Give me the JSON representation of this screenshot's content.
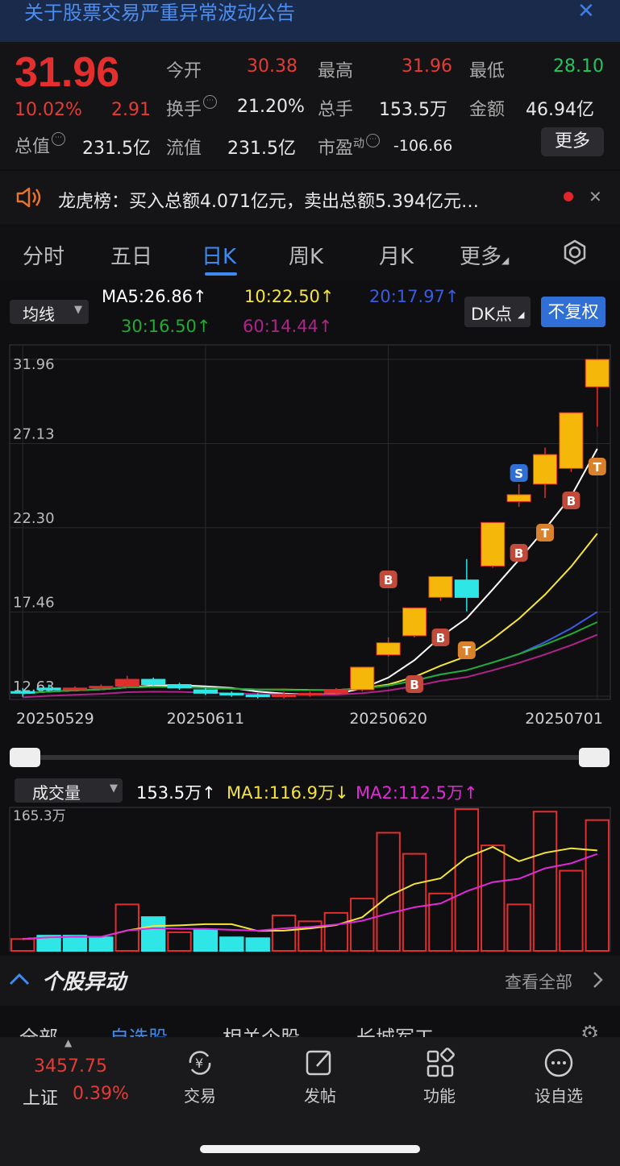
{
  "banner": {
    "title": "关于股票交易严重异常波动公告",
    "close": "✕"
  },
  "quote": {
    "price": "31.96",
    "pct": "10.02%",
    "change": "2.91",
    "open_label": "今开",
    "open": "30.38",
    "high_label": "最高",
    "high": "31.96",
    "low_label": "最低",
    "low": "28.10",
    "turnover_label": "换手",
    "turnover": "21.20%",
    "volume_label": "总手",
    "volume": "153.5万",
    "amount_label": "金额",
    "amount": "46.94亿",
    "mktcap_label": "总值",
    "mktcap": "231.5亿",
    "float_label": "流值",
    "float": "231.5亿",
    "pe_label": "市盈",
    "pe_sup": "动",
    "pe": "-106.66",
    "more": "更多"
  },
  "notice": {
    "text": "龙虎榜：买入总额4.071亿元，卖出总额5.394亿元…",
    "close": "✕"
  },
  "tabs": [
    "分时",
    "五日",
    "日K",
    "周K",
    "月K",
    "更多"
  ],
  "ma_bar": {
    "selector": "均线",
    "ma5": "MA5:26.86↑",
    "ma10": "10:22.50↑",
    "ma20": "20:17.97↑",
    "ma30": "30:16.50↑",
    "ma60": "60:14.44↑",
    "dk": "DK点",
    "fq": "不复权"
  },
  "chart_data": {
    "type": "candlestick",
    "y_ticks": [
      "31.96",
      "27.13",
      "22.30",
      "17.46",
      "12.63"
    ],
    "ylim": [
      12.63,
      31.96
    ],
    "x_ticks": [
      "20250529",
      "20250611",
      "20250620",
      "20250701"
    ],
    "candles": [
      {
        "o": 12.9,
        "c": 12.8,
        "h": 13.1,
        "l": 12.6
      },
      {
        "o": 13.1,
        "c": 13.0,
        "h": 13.3,
        "l": 12.9
      },
      {
        "o": 13.0,
        "c": 13.1,
        "h": 13.2,
        "l": 12.9
      },
      {
        "o": 13.1,
        "c": 13.2,
        "h": 13.3,
        "l": 13.0
      },
      {
        "o": 13.2,
        "c": 13.6,
        "h": 13.8,
        "l": 13.1
      },
      {
        "o": 13.6,
        "c": 13.3,
        "h": 13.7,
        "l": 13.2
      },
      {
        "o": 13.3,
        "c": 13.1,
        "h": 13.4,
        "l": 13.0
      },
      {
        "o": 13.0,
        "c": 12.8,
        "h": 13.1,
        "l": 12.7
      },
      {
        "o": 12.8,
        "c": 12.7,
        "h": 12.9,
        "l": 12.6
      },
      {
        "o": 12.7,
        "c": 12.6,
        "h": 12.8,
        "l": 12.5
      },
      {
        "o": 12.6,
        "c": 12.7,
        "h": 12.9,
        "l": 12.5
      },
      {
        "o": 12.7,
        "c": 12.8,
        "h": 12.9,
        "l": 12.6
      },
      {
        "o": 12.8,
        "c": 13.0,
        "h": 13.1,
        "l": 12.7
      },
      {
        "o": 13.0,
        "c": 14.3,
        "h": 14.3,
        "l": 12.9
      },
      {
        "o": 15.0,
        "c": 15.7,
        "h": 16.0,
        "l": 14.9
      },
      {
        "o": 16.1,
        "c": 17.7,
        "h": 17.7,
        "l": 16.0
      },
      {
        "o": 18.3,
        "c": 19.5,
        "h": 19.5,
        "l": 18.1
      },
      {
        "o": 19.3,
        "c": 18.3,
        "h": 20.5,
        "l": 17.5
      },
      {
        "o": 20.1,
        "c": 22.6,
        "h": 22.6,
        "l": 20.0
      },
      {
        "o": 23.8,
        "c": 24.2,
        "h": 24.8,
        "l": 23.5
      },
      {
        "o": 24.8,
        "c": 26.5,
        "h": 26.9,
        "l": 24.0
      },
      {
        "o": 25.7,
        "c": 28.9,
        "h": 28.9,
        "l": 25.5
      },
      {
        "o": 30.38,
        "c": 31.96,
        "h": 31.96,
        "l": 28.1
      }
    ],
    "ma_series": [
      {
        "name": "MA5",
        "color": "#ffffff"
      },
      {
        "name": "MA10",
        "color": "#f5e53a"
      },
      {
        "name": "MA20",
        "color": "#3a5ce0"
      },
      {
        "name": "MA30",
        "color": "#22aa33"
      },
      {
        "name": "MA60",
        "color": "#b0248a"
      }
    ],
    "markers": [
      "B",
      "B",
      "B",
      "S",
      "B",
      "T",
      "B",
      "T",
      "T"
    ]
  },
  "volume": {
    "selector": "成交量",
    "vol": "153.5万↑",
    "ma1": "MA1:116.9万↓",
    "ma2": "MA2:112.5万↑",
    "max": "165.3万",
    "values": [
      14,
      18,
      18,
      16,
      55,
      40,
      22,
      25,
      16,
      15,
      42,
      35,
      45,
      62,
      140,
      115,
      68,
      168,
      125,
      55,
      165,
      95,
      155
    ]
  },
  "abnormal": {
    "title": "个股异动",
    "viewall": "查看全部",
    "tabs": [
      "全部",
      "自选股",
      "相关个股",
      "长城军工"
    ]
  },
  "bottom": {
    "index_val": "3457.75",
    "index_name": "上证",
    "index_pct": "0.39%",
    "nav": [
      "交易",
      "发帖",
      "功能",
      "设自选"
    ]
  }
}
